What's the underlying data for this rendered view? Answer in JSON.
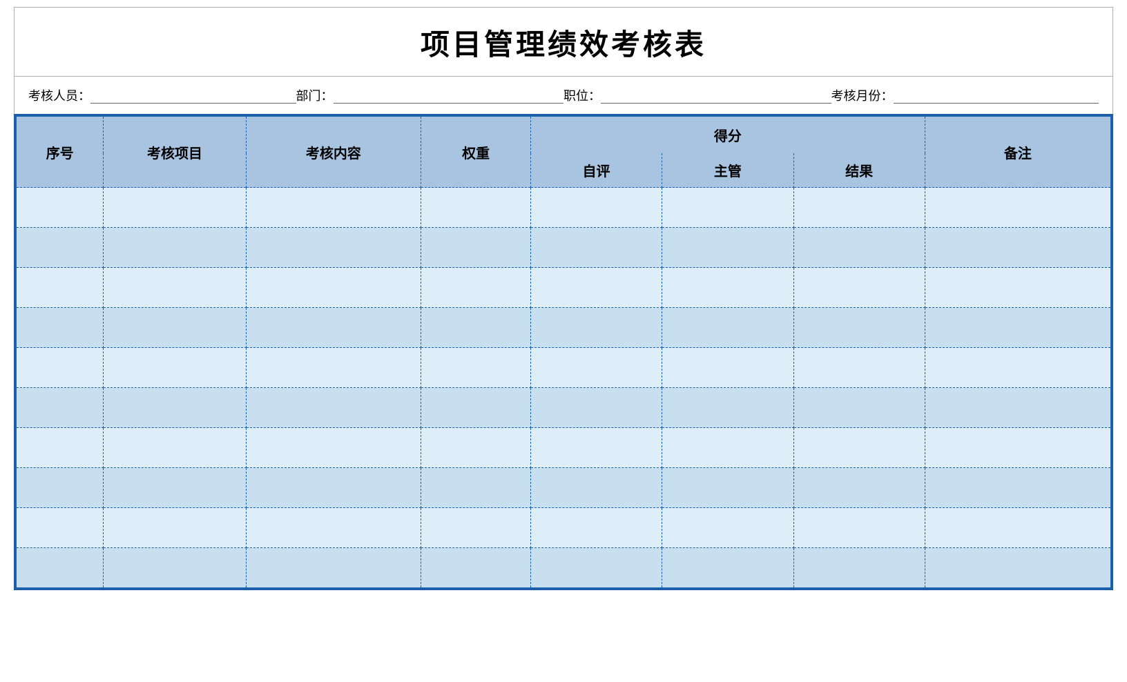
{
  "title": "项目管理绩效考核表",
  "info": {
    "person_label": "考核人员：",
    "dept_label": "部门：",
    "position_label": "职位：",
    "month_label": "考核月份："
  },
  "table": {
    "headers_top": {
      "seq": "序号",
      "item": "考核项目",
      "content": "考核内容",
      "weight": "权重",
      "score": "得分",
      "note": "备注"
    },
    "headers_bottom": {
      "self": "自评",
      "manager": "主管",
      "result": "结果"
    },
    "data_rows": 10
  }
}
